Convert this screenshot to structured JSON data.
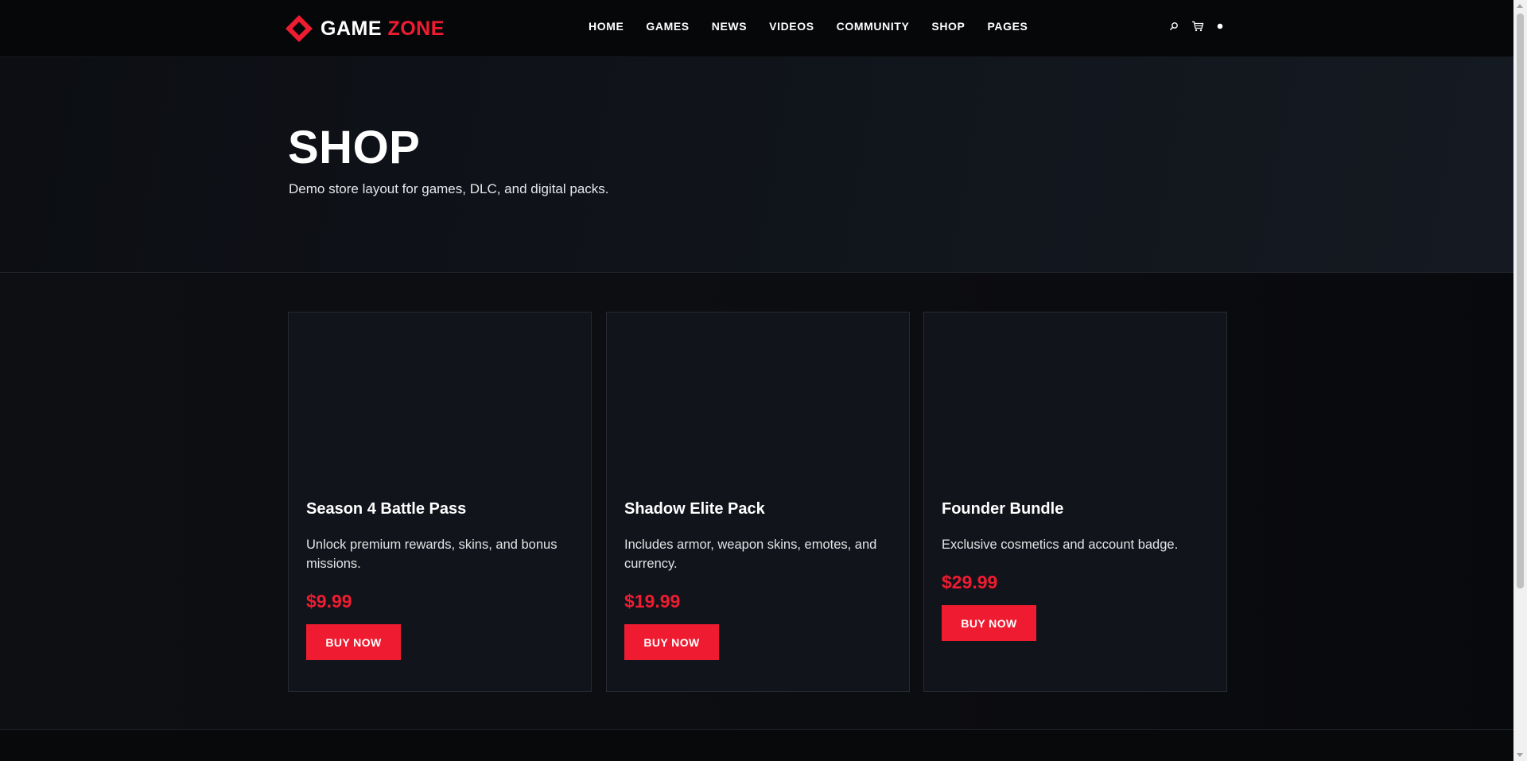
{
  "brand": {
    "word1": "GAME",
    "word2": "ZONE",
    "accent_color": "#ef1c31"
  },
  "nav": {
    "items": [
      {
        "label": "HOME"
      },
      {
        "label": "GAMES"
      },
      {
        "label": "NEWS"
      },
      {
        "label": "VIDEOS"
      },
      {
        "label": "COMMUNITY"
      },
      {
        "label": "SHOP"
      },
      {
        "label": "PAGES"
      }
    ]
  },
  "header_icons": [
    "search-icon",
    "cart-icon",
    "account-dot-icon"
  ],
  "hero": {
    "title": "SHOP",
    "subtitle": "Demo store layout for games, DLC, and digital packs."
  },
  "products": [
    {
      "title": "Season 4 Battle Pass",
      "description": "Unlock premium rewards, skins, and bonus missions.",
      "price": "$9.99",
      "button": "BUY NOW"
    },
    {
      "title": "Shadow Elite Pack",
      "description": "Includes armor, weapon skins, emotes, and currency.",
      "price": "$19.99",
      "button": "BUY NOW"
    },
    {
      "title": "Founder Bundle",
      "description": "Exclusive cosmetics and account badge.",
      "price": "$29.99",
      "button": "BUY NOW"
    }
  ]
}
